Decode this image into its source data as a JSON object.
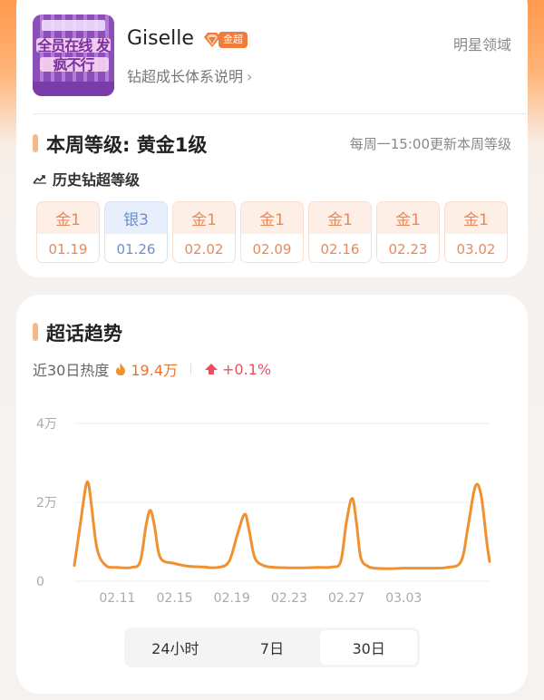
{
  "profile": {
    "avatar_text": "全员在线 发疯不行",
    "name": "Giselle",
    "badge_label": "金超",
    "growth_link": "钻超成长体系说明",
    "domain": "明星领域"
  },
  "week_level": {
    "title": "本周等级: 黄金1级",
    "note": "每周一15:00更新本周等级"
  },
  "history": {
    "title": "历史钻超等级",
    "levels": [
      {
        "level": "金1",
        "date": "01.19",
        "tier": "gold"
      },
      {
        "level": "银3",
        "date": "01.26",
        "tier": "silver"
      },
      {
        "level": "金1",
        "date": "02.02",
        "tier": "gold"
      },
      {
        "level": "金1",
        "date": "02.09",
        "tier": "gold"
      },
      {
        "level": "金1",
        "date": "02.16",
        "tier": "gold"
      },
      {
        "level": "金1",
        "date": "02.23",
        "tier": "gold"
      },
      {
        "level": "金1",
        "date": "03.02",
        "tier": "gold"
      }
    ]
  },
  "trend": {
    "title": "超话趋势",
    "heat_label": "近30日热度",
    "heat_value": "19.4万",
    "heat_change": "+0.1%",
    "icons": {
      "heat": "flame-icon",
      "change": "arrow-up-icon"
    },
    "colors": {
      "line": "#f0902e",
      "heat": "#e8742c",
      "change": "#ee4d5f"
    }
  },
  "chart_data": {
    "type": "line",
    "ylim": [
      0,
      40000
    ],
    "yticks": [
      {
        "value": 0,
        "label": "0"
      },
      {
        "value": 20000,
        "label": "2万"
      },
      {
        "value": 40000,
        "label": "4万"
      }
    ],
    "xlim": [
      0,
      29
    ],
    "xticks": [
      {
        "value": 3,
        "label": "02.11"
      },
      {
        "value": 7,
        "label": "02.15"
      },
      {
        "value": 11,
        "label": "02.19"
      },
      {
        "value": 15,
        "label": "02.23"
      },
      {
        "value": 19,
        "label": "02.27"
      },
      {
        "value": 23,
        "label": "03.03"
      }
    ],
    "x": [
      0,
      0.4,
      0.8,
      1.0,
      1.2,
      1.6,
      2.2,
      3.0,
      4.0,
      4.6,
      5.0,
      5.3,
      5.6,
      6.0,
      7.0,
      8.0,
      9.0,
      10.0,
      10.8,
      11.4,
      11.9,
      12.2,
      12.6,
      13.2,
      14.0,
      15.0,
      16.0,
      17.0,
      18.0,
      18.6,
      19.0,
      19.4,
      19.7,
      20.0,
      20.5,
      21.0,
      22.0,
      23.0,
      24.0,
      25.0,
      26.0,
      27.0,
      27.5,
      28.0,
      28.4,
      28.8,
      29.0
    ],
    "values": [
      4000,
      14000,
      24000,
      24500,
      19000,
      8000,
      4000,
      3500,
      3500,
      5000,
      14000,
      18000,
      14000,
      6000,
      4500,
      3800,
      3600,
      3500,
      5000,
      12000,
      17000,
      13000,
      6000,
      4000,
      3500,
      3400,
      3400,
      3500,
      3600,
      5000,
      15000,
      21000,
      15000,
      6000,
      3800,
      3300,
      3200,
      3300,
      3300,
      3300,
      3500,
      5000,
      14000,
      24000,
      22000,
      10000,
      5000
    ]
  },
  "range_tabs": [
    {
      "label": "24小时",
      "active": false
    },
    {
      "label": "7日",
      "active": false
    },
    {
      "label": "30日",
      "active": true
    }
  ]
}
